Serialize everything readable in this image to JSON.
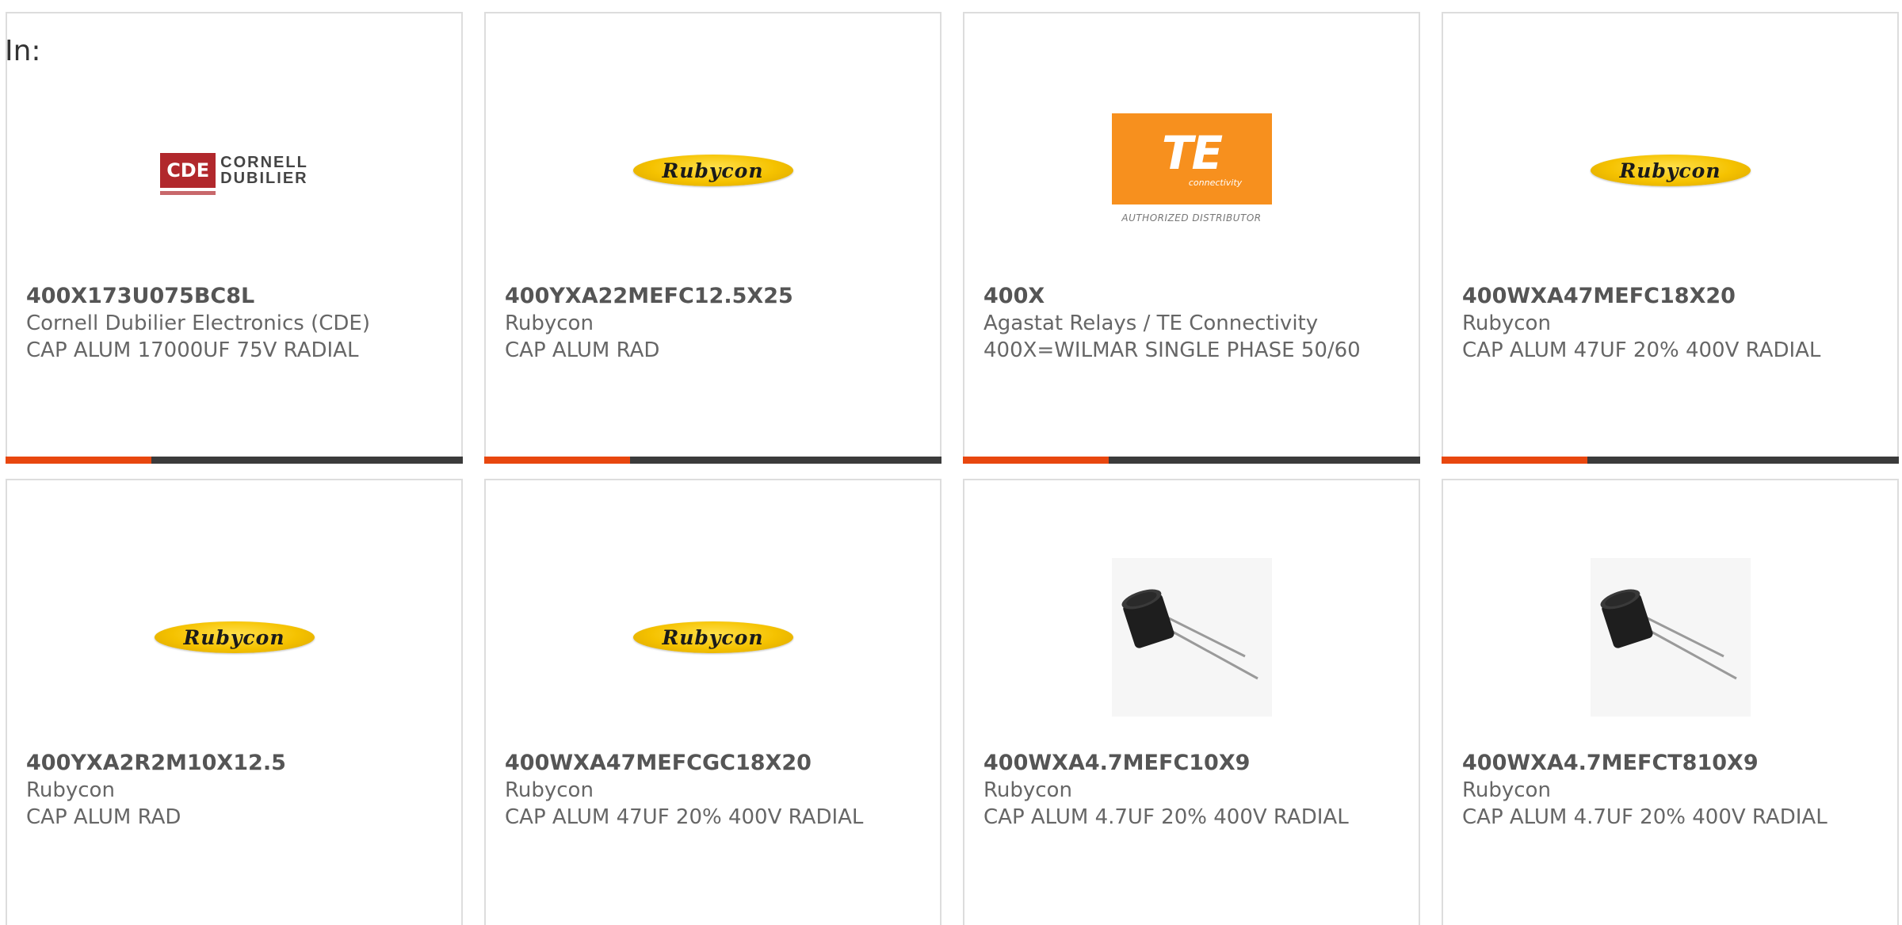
{
  "header": {
    "label": "In:"
  },
  "logos": {
    "cde_box": "CDE",
    "cde_words_1": "CORNELL",
    "cde_words_2": "DUBILIER",
    "rubycon": "Rubycon",
    "te_mark": "TE",
    "te_sub": "connectivity",
    "te_auth": "AUTHORIZED DISTRIBUTOR"
  },
  "colors": {
    "accent": "#e8470f",
    "bar": "#3b3b3b",
    "rubycon_yellow": "#f5c200",
    "te_orange": "#f7901e",
    "cde_red": "#b1282c"
  },
  "products": [
    {
      "part_number": "400X173U075BC8L",
      "manufacturer": "Cornell Dubilier Electronics (CDE)",
      "description": "CAP ALUM 17000UF 75V RADIAL",
      "logo": "cde-logo"
    },
    {
      "part_number": "400YXA22MEFC12.5X25",
      "manufacturer": "Rubycon",
      "description": "CAP ALUM RAD",
      "logo": "rubycon-logo"
    },
    {
      "part_number": "400X",
      "manufacturer": "Agastat Relays / TE Connectivity",
      "description": "400X=WILMAR SINGLE PHASE 50/60",
      "logo": "te-connectivity-logo"
    },
    {
      "part_number": "400WXA47MEFC18X20",
      "manufacturer": "Rubycon",
      "description": "CAP ALUM 47UF 20% 400V RADIAL",
      "logo": "rubycon-logo"
    },
    {
      "part_number": "400YXA2R2M10X12.5",
      "manufacturer": "Rubycon",
      "description": "CAP ALUM RAD",
      "logo": "rubycon-logo"
    },
    {
      "part_number": "400WXA47MEFCGC18X20",
      "manufacturer": "Rubycon",
      "description": "CAP ALUM 47UF 20% 400V RADIAL",
      "logo": "rubycon-logo"
    },
    {
      "part_number": "400WXA4.7MEFC10X9",
      "manufacturer": "Rubycon",
      "description": "CAP ALUM 4.7UF 20% 400V RADIAL",
      "logo": "capacitor-photo"
    },
    {
      "part_number": "400WXA4.7MEFCT810X9",
      "manufacturer": "Rubycon",
      "description": "CAP ALUM 4.7UF 20% 400V RADIAL",
      "logo": "capacitor-photo"
    }
  ]
}
